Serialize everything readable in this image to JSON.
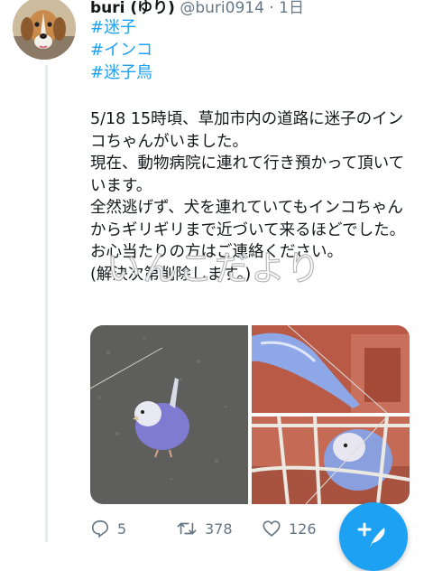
{
  "tweet": {
    "display_name": "buri (ゆり)",
    "handle": "@buri0914",
    "separator": "·",
    "time": "1日",
    "hashtags": [
      "#迷子",
      "#インコ",
      "#迷子鳥"
    ],
    "body": "5/18 15時頃、草加市内の道路に迷子のインコちゃんがいました。\n現在、動物病院に連れて行き預かって頂いています。\n全然逃げず、犬を連れていてもインコちゃんからギリギリまで近づいて来るほどでした。\nお心当たりの方はご連絡ください。\n(解決次第削除します。)",
    "watermark": "いんこだより"
  },
  "stats": {
    "replies": "5",
    "retweets": "378",
    "likes": "126"
  },
  "icons": [
    "reply-icon",
    "retweet-icon",
    "like-icon",
    "compose-tweet-icon"
  ],
  "colors": {
    "accent": "#1da1f2",
    "muted": "#657786",
    "text": "#14171a"
  }
}
